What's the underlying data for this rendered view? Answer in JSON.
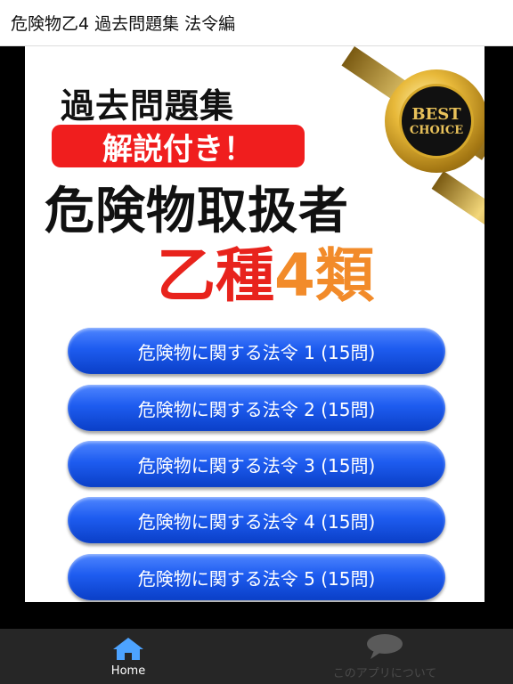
{
  "appbar": {
    "title": "危険物乙4 過去問題集 法令編"
  },
  "banner": {
    "subtitle": "過去問題集",
    "badge": "解説付き！",
    "main_title": "危険物取扱者",
    "kind_red": "乙種",
    "kind_orange": "4類",
    "seal_line1": "BEST",
    "seal_line2": "CHOICE"
  },
  "buttons": [
    {
      "label": "危険物に関する法令 1 (15問)"
    },
    {
      "label": "危険物に関する法令 2 (15問)"
    },
    {
      "label": "危険物に関する法令 3 (15問)"
    },
    {
      "label": "危険物に関する法令 4 (15問)"
    },
    {
      "label": "危険物に関する法令 5 (15問)"
    }
  ],
  "bottom_nav": {
    "home": {
      "label": "Home",
      "icon": "home-icon"
    },
    "about": {
      "label": "このアプリについて",
      "icon": "speech-bubble-icon"
    }
  },
  "colors": {
    "button_blue": "#1e5cf0",
    "badge_red": "#f01e1e",
    "kind_red": "#e8231c",
    "kind_orange": "#f28b2a",
    "nav_bg": "#262626"
  }
}
